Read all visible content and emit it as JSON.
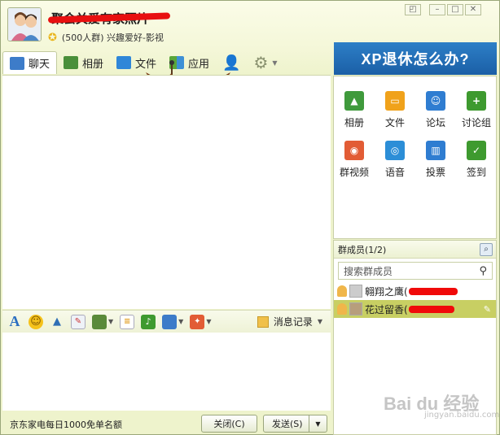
{
  "window": {
    "title": "聚会关爱有家照片",
    "member_info": "(500人群) 兴趣爱好-影视",
    "controls": [
      "◰",
      "–",
      "□",
      "✕"
    ]
  },
  "tabs": [
    {
      "label": "聊天",
      "icon": "chat-icon",
      "color": "#3d7cc9"
    },
    {
      "label": "相册",
      "icon": "photo-album-icon",
      "color": "#4a8f3a"
    },
    {
      "label": "文件",
      "icon": "folder-icon",
      "color": "#2f86d8"
    },
    {
      "label": "应用",
      "icon": "apps-icon",
      "color": "#5aa63a"
    }
  ],
  "banner": {
    "text": "XP退休怎么办?"
  },
  "apps": [
    {
      "label": "相册",
      "icon": "photo-icon",
      "color": "#3f9a3c",
      "glyph": "▲"
    },
    {
      "label": "文件",
      "icon": "folder-icon",
      "color": "#f0a21b",
      "glyph": "▭"
    },
    {
      "label": "论坛",
      "icon": "forum-icon",
      "color": "#2f7dd1",
      "glyph": "☺"
    },
    {
      "label": "讨论组",
      "icon": "discussion-icon",
      "color": "#3e9a2f",
      "glyph": "+"
    },
    {
      "label": "群视频",
      "icon": "video-icon",
      "color": "#e25c35",
      "glyph": "◉"
    },
    {
      "label": "语音",
      "icon": "voice-icon",
      "color": "#2c8ed7",
      "glyph": "◎"
    },
    {
      "label": "投票",
      "icon": "vote-icon",
      "color": "#2f7dd1",
      "glyph": "▥"
    },
    {
      "label": "签到",
      "icon": "checkin-icon",
      "color": "#3e9a2f",
      "glyph": "✓"
    }
  ],
  "members": {
    "header": "群成员(1/2)",
    "search_placeholder": "搜索群成员",
    "list": [
      {
        "name": "翱翔之鹰(",
        "selected": false
      },
      {
        "name": "花过留香(",
        "selected": true
      }
    ]
  },
  "toolbar": {
    "history_label": "消息记录"
  },
  "bottom": {
    "promo": "京东家电每日1000免单名额",
    "close_label": "关闭(C)",
    "send_label": "发送(S)"
  },
  "watermark": {
    "logo": "Bai du 经验",
    "url": "jingyan.baidu.com"
  }
}
